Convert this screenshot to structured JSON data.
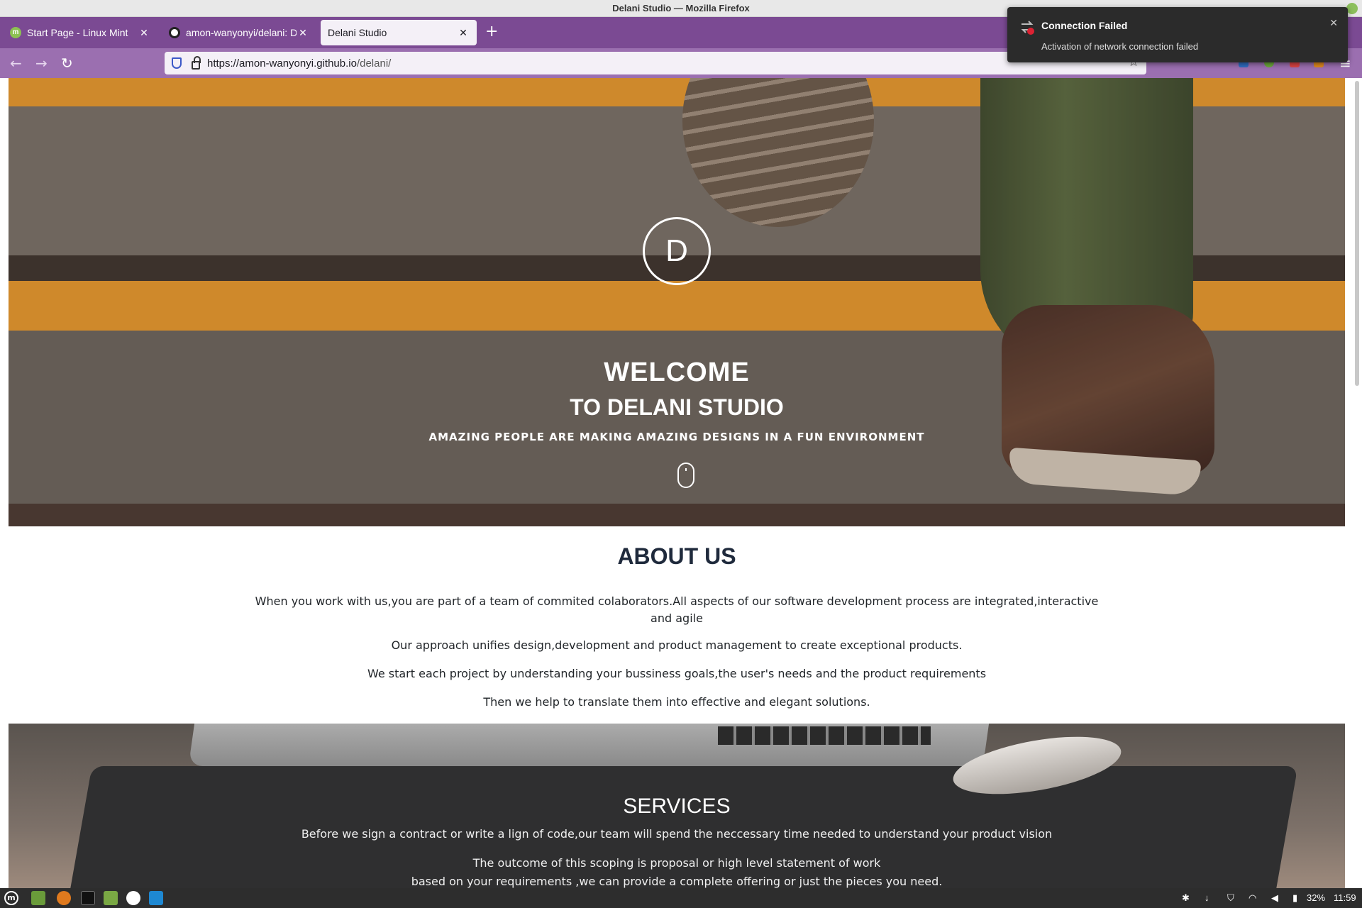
{
  "window": {
    "title": "Delani Studio — Mozilla Firefox"
  },
  "tabs": [
    {
      "label": "Start Page - Linux Mint",
      "active": false
    },
    {
      "label": "amon-wanyonyi/delani: Del",
      "active": false
    },
    {
      "label": "Delani Studio",
      "active": true
    }
  ],
  "url": {
    "domain": "https://amon-wanyonyi.github.io",
    "path": "/delani/"
  },
  "notification": {
    "title": "Connection Failed",
    "body": "Activation of network connection failed"
  },
  "hero": {
    "logo_letter": "D",
    "title_line1": "WELCOME",
    "title_line2": "TO DELANI STUDIO",
    "subtitle": "AMAZING PEOPLE ARE MAKING AMAZING DESIGNS IN A FUN ENVIRONMENT"
  },
  "about": {
    "title": "ABOUT US",
    "paragraphs": [
      "When you work with us,you are part of a team of commited colaborators.All aspects of our software development process are integrated,interactive and agile",
      "Our approach unifies design,development and product management to create exceptional products.",
      "We start each project by understanding your bussiness goals,the user's needs and the product requirements",
      "Then we help to translate them into effective and elegant solutions."
    ]
  },
  "services": {
    "title": "SERVICES",
    "paragraphs": [
      "Before we sign a contract or write a lign of code,our team will spend the neccessary time needed to understand your product vision",
      "The outcome of this scoping is proposal or high level statement of work",
      "based on your requirements ,we can provide a complete offering or just the pieces you need."
    ]
  },
  "taskbar": {
    "battery": "32%",
    "clock": "11:59"
  },
  "colors": {
    "tabstrip": "#7b4a93",
    "navbar": "#9b6fb0",
    "hero_orange": "#e99a2e"
  }
}
